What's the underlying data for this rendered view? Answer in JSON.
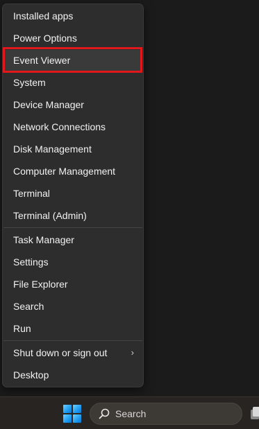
{
  "menu": {
    "items": [
      {
        "label": "Installed apps"
      },
      {
        "label": "Power Options"
      },
      {
        "label": "Event Viewer"
      },
      {
        "label": "System"
      },
      {
        "label": "Device Manager"
      },
      {
        "label": "Network Connections"
      },
      {
        "label": "Disk Management"
      },
      {
        "label": "Computer Management"
      },
      {
        "label": "Terminal"
      },
      {
        "label": "Terminal (Admin)"
      },
      {
        "label": "Task Manager"
      },
      {
        "label": "Settings"
      },
      {
        "label": "File Explorer"
      },
      {
        "label": "Search"
      },
      {
        "label": "Run"
      },
      {
        "label": "Shut down or sign out"
      },
      {
        "label": "Desktop"
      }
    ],
    "highlighted_item": "Event Viewer",
    "highlight_color": "#e0171b",
    "submenu_chevron": "›"
  },
  "taskbar": {
    "search_label": "Search",
    "start_icon": "windows-logo-icon",
    "search_icon": "search-icon"
  }
}
